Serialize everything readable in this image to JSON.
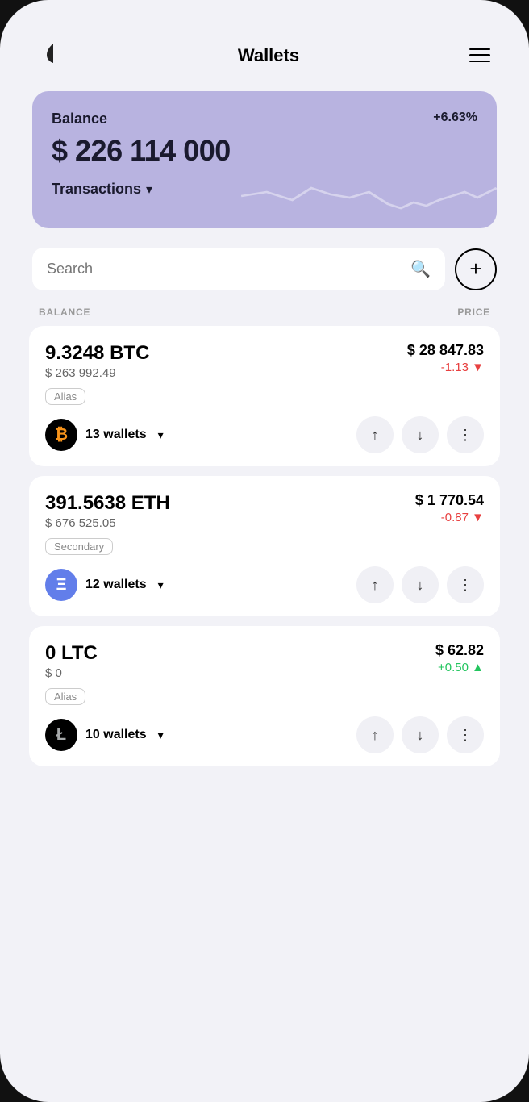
{
  "header": {
    "title": "Wallets",
    "menu_label": "menu"
  },
  "balance_card": {
    "label": "Balance",
    "percent": "+6.63%",
    "amount": "$ 226 114 000",
    "transactions_label": "Transactions"
  },
  "search": {
    "placeholder": "Search",
    "add_button_label": "+"
  },
  "table_headers": {
    "balance_col": "BALANCE",
    "price_col": "PRICE"
  },
  "coins": [
    {
      "id": "btc",
      "amount": "9.3248 BTC",
      "usd_value": "$ 263 992.49",
      "alias": "Alias",
      "price": "$ 28 847.83",
      "price_change": "-1.13",
      "price_direction": "down",
      "wallets_count": "13 wallets",
      "logo_symbol": "₿",
      "logo_class": "coin-logo-btc"
    },
    {
      "id": "eth",
      "amount": "391.5638 ETH",
      "usd_value": "$ 676 525.05",
      "alias": "Secondary",
      "price": "$ 1 770.54",
      "price_change": "-0.87",
      "price_direction": "down",
      "wallets_count": "12 wallets",
      "logo_symbol": "Ξ",
      "logo_class": "coin-logo-eth"
    },
    {
      "id": "ltc",
      "amount": "0 LTC",
      "usd_value": "$ 0",
      "alias": "Alias",
      "price": "$ 62.82",
      "price_change": "+0.50",
      "price_direction": "up",
      "wallets_count": "10 wallets",
      "logo_symbol": "Ł",
      "logo_class": "coin-logo-ltc"
    }
  ],
  "icons": {
    "send": "↑",
    "receive": "↓",
    "more": "⋮",
    "search": "⌕",
    "chevron_down": "▾"
  }
}
